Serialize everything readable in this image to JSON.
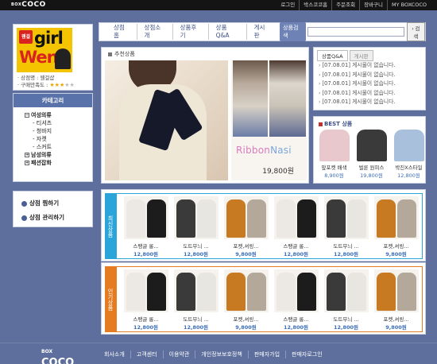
{
  "topbar": {
    "logo_small": "COCO",
    "logo_small_prefix": "BOX",
    "links": [
      "로그인",
      "박스코코홈",
      "주문조회",
      "장바구니",
      "MY BOXCOCO"
    ]
  },
  "shop": {
    "logo_badge": "웬걸",
    "logo_line1": "girl",
    "logo_line2": "Wen",
    "name_line": "· 상점명 : 웬걸샵",
    "rating_label": "· 구매만족도 :",
    "rating": 3,
    "rating_max": 5
  },
  "category": {
    "title": "카테고리",
    "items": [
      {
        "label": "여성의류",
        "type": "main",
        "box": "−"
      },
      {
        "label": "- 티셔츠",
        "type": "sub"
      },
      {
        "label": "- 청바지",
        "type": "sub"
      },
      {
        "label": "- 자켓",
        "type": "sub"
      },
      {
        "label": "- 스커트",
        "type": "sub"
      },
      {
        "label": "남성의류",
        "type": "main",
        "box": "+"
      },
      {
        "label": "패션잡화",
        "type": "main",
        "box": "+"
      }
    ]
  },
  "manage": {
    "items": [
      "상점 찜하기",
      "상점 관리하기"
    ]
  },
  "nav": {
    "items": [
      "상점홈",
      "상점소개",
      "상품후기",
      "상품Q&A",
      "게시판"
    ],
    "search_label": "상품검색",
    "search_button": "검색"
  },
  "featured": {
    "title": "추천상품",
    "brand_part1": "Ribbon",
    "brand_part2": "Nasi",
    "price": "19,800원"
  },
  "qa": {
    "tab_active": "상품Q&A",
    "tab_inactive": "게시판",
    "rows": [
      "[07.08.01] 게시물이 없습니다.",
      "[07.08.01] 게시물이 없습니다.",
      "[07.08.01] 게시물이 없습니다.",
      "[07.08.01] 게시물이 없습니다.",
      "[07.08.01] 게시물이 없습니다."
    ]
  },
  "best": {
    "title": "BEST 상품",
    "items": [
      {
        "name": "앞포켓 배색",
        "price": "8,900원",
        "color": "#e8c8cc"
      },
      {
        "name": "벌룬 원피스",
        "price": "19,800원",
        "color": "#3a3a3a"
      },
      {
        "name": "박진X스타일",
        "price": "12,800원",
        "color": "#a8c0dc"
      }
    ]
  },
  "new_products": {
    "label": "최신상품",
    "items": [
      {
        "name": "스팽글 롱...",
        "price": "12,800원",
        "c1": "#ece9e4",
        "c2": "#1c1c1c"
      },
      {
        "name": "도트무늬 ...",
        "price": "12,800원",
        "c1": "#3a3a3a",
        "c2": "#e8e6e1"
      },
      {
        "name": "포켓,셔링...",
        "price": "9,800원",
        "c1": "#c87a22",
        "c2": "#b3a89a"
      },
      {
        "name": "스팽글 롱...",
        "price": "12,800원",
        "c1": "#ece9e4",
        "c2": "#1c1c1c"
      },
      {
        "name": "도트무늬 ...",
        "price": "12,800원",
        "c1": "#3a3a3a",
        "c2": "#e8e6e1"
      },
      {
        "name": "포켓,셔링...",
        "price": "9,800원",
        "c1": "#c87a22",
        "c2": "#b3a89a"
      }
    ]
  },
  "popular_products": {
    "label": "인기상품",
    "items": [
      {
        "name": "스팽글 롱...",
        "price": "12,800원",
        "c1": "#ece9e4",
        "c2": "#1c1c1c"
      },
      {
        "name": "도트무늬 ...",
        "price": "12,800원",
        "c1": "#3a3a3a",
        "c2": "#e8e6e1"
      },
      {
        "name": "포켓,셔링...",
        "price": "9,800원",
        "c1": "#c87a22",
        "c2": "#b3a89a"
      },
      {
        "name": "스팽글 롱...",
        "price": "12,800원",
        "c1": "#ece9e4",
        "c2": "#1c1c1c"
      },
      {
        "name": "도트무늬 ...",
        "price": "12,800원",
        "c1": "#3a3a3a",
        "c2": "#e8e6e1"
      },
      {
        "name": "포켓,셔링...",
        "price": "9,800원",
        "c1": "#c87a22",
        "c2": "#b3a89a"
      }
    ]
  },
  "footer": {
    "logo_prefix": "BOX",
    "logo": "COCO",
    "links": [
      "회사소개",
      "고객센터",
      "이용약관",
      "개인정보보호정책",
      "판매자가입",
      "판매자로그인"
    ]
  },
  "colors": {
    "accent": "#5a72aa",
    "new_bar": "#2aa4d9",
    "popular_bar": "#e67c21",
    "price": "#3c6fb7"
  }
}
